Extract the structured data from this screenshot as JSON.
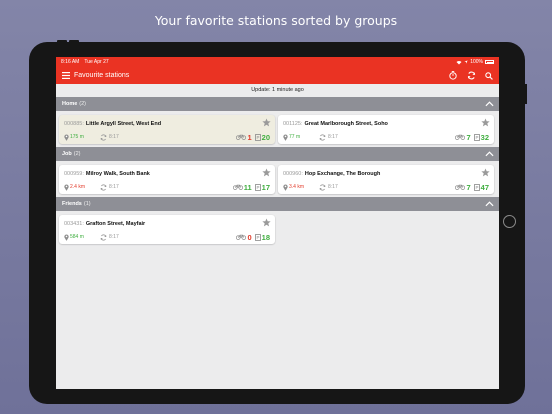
{
  "headline": "Your favorite stations sorted by groups",
  "status_bar": {
    "time": "8:16 AM",
    "date": "Tue Apr 27",
    "battery": "100%"
  },
  "app_bar": {
    "title": "Favourite stations"
  },
  "update_text": "Update: 1 minute ago",
  "groups": [
    {
      "name": "Home",
      "count": "(2)",
      "stations": [
        {
          "code": "000885:",
          "name": "Little Argyll Street, West End",
          "distance": "175 m",
          "updated": "8:17",
          "bikes": "1",
          "docks": "20",
          "highlight": true
        },
        {
          "code": "001125:",
          "name": "Great Marlborough Street, Soho",
          "distance": "77 m",
          "updated": "8:17",
          "bikes": "7",
          "docks": "32",
          "highlight": false
        }
      ]
    },
    {
      "name": "Job",
      "count": "(2)",
      "stations": [
        {
          "code": "000959:",
          "name": "Milroy Walk, South Bank",
          "distance": "2.4 km",
          "updated": "8:17",
          "bikes": "11",
          "docks": "17",
          "highlight": false
        },
        {
          "code": "000960:",
          "name": "Hop Exchange, The Borough",
          "distance": "3.4 km",
          "updated": "8:17",
          "bikes": "7",
          "docks": "47",
          "highlight": false
        }
      ]
    },
    {
      "name": "Friends",
      "count": "(1)",
      "stations": [
        {
          "code": "003431:",
          "name": "Grafton Street, Mayfair",
          "distance": "584 m",
          "updated": "8:17",
          "bikes": "0",
          "docks": "18",
          "highlight": false
        }
      ]
    }
  ],
  "colors": {
    "accent": "#ea3323",
    "group_header": "#8e8f96",
    "available": "#3fae3f",
    "empty": "#e23a2a"
  },
  "icons": [
    "menu-icon",
    "timer-icon",
    "refresh-icon",
    "search-icon",
    "chevron-up-icon",
    "star-icon",
    "location-pin-icon",
    "sync-icon",
    "bike-icon",
    "dock-icon"
  ]
}
